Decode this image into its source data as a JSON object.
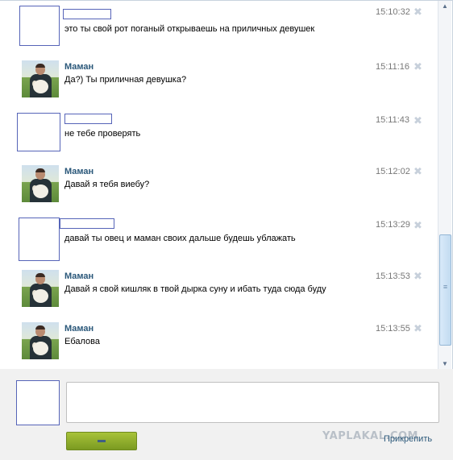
{
  "messages": [
    {
      "sender": "",
      "avatar": "blank",
      "time": "15:10:32",
      "text": "это ты свой рот поганый открываешь на приличных девушек"
    },
    {
      "sender": "Маман",
      "avatar": "photo",
      "time": "15:11:16",
      "text": "Да?) Ты приличная девушка?"
    },
    {
      "sender": "",
      "avatar": "blank",
      "time": "15:11:43",
      "text": "не тебе проверять"
    },
    {
      "sender": "Маман",
      "avatar": "photo",
      "time": "15:12:02",
      "text": "Давай я тебя виебу?"
    },
    {
      "sender": "",
      "avatar": "blank",
      "time": "15:13:29",
      "text": "давай ты овец и маман своих дальше будешь ублажать"
    },
    {
      "sender": "Маман",
      "avatar": "photo",
      "time": "15:13:53",
      "text": "Давай я свой кишляк в твой дырка суну и ибать туда сюда буду"
    },
    {
      "sender": "Маман",
      "avatar": "photo",
      "time": "15:13:55",
      "text": "Ебалова"
    }
  ],
  "delete_glyph": "✖",
  "compose": {
    "attach_label": "Прикрепить",
    "watermark": "YAPLAKAL.COM"
  },
  "icons": {
    "delete": "close-icon",
    "scroll_up": "arrow-up-icon",
    "scroll_down": "arrow-down-icon"
  },
  "colors": {
    "sender": "#2b587a",
    "send_button": "#8aab2b",
    "placeholder_border": "#5664b8"
  }
}
